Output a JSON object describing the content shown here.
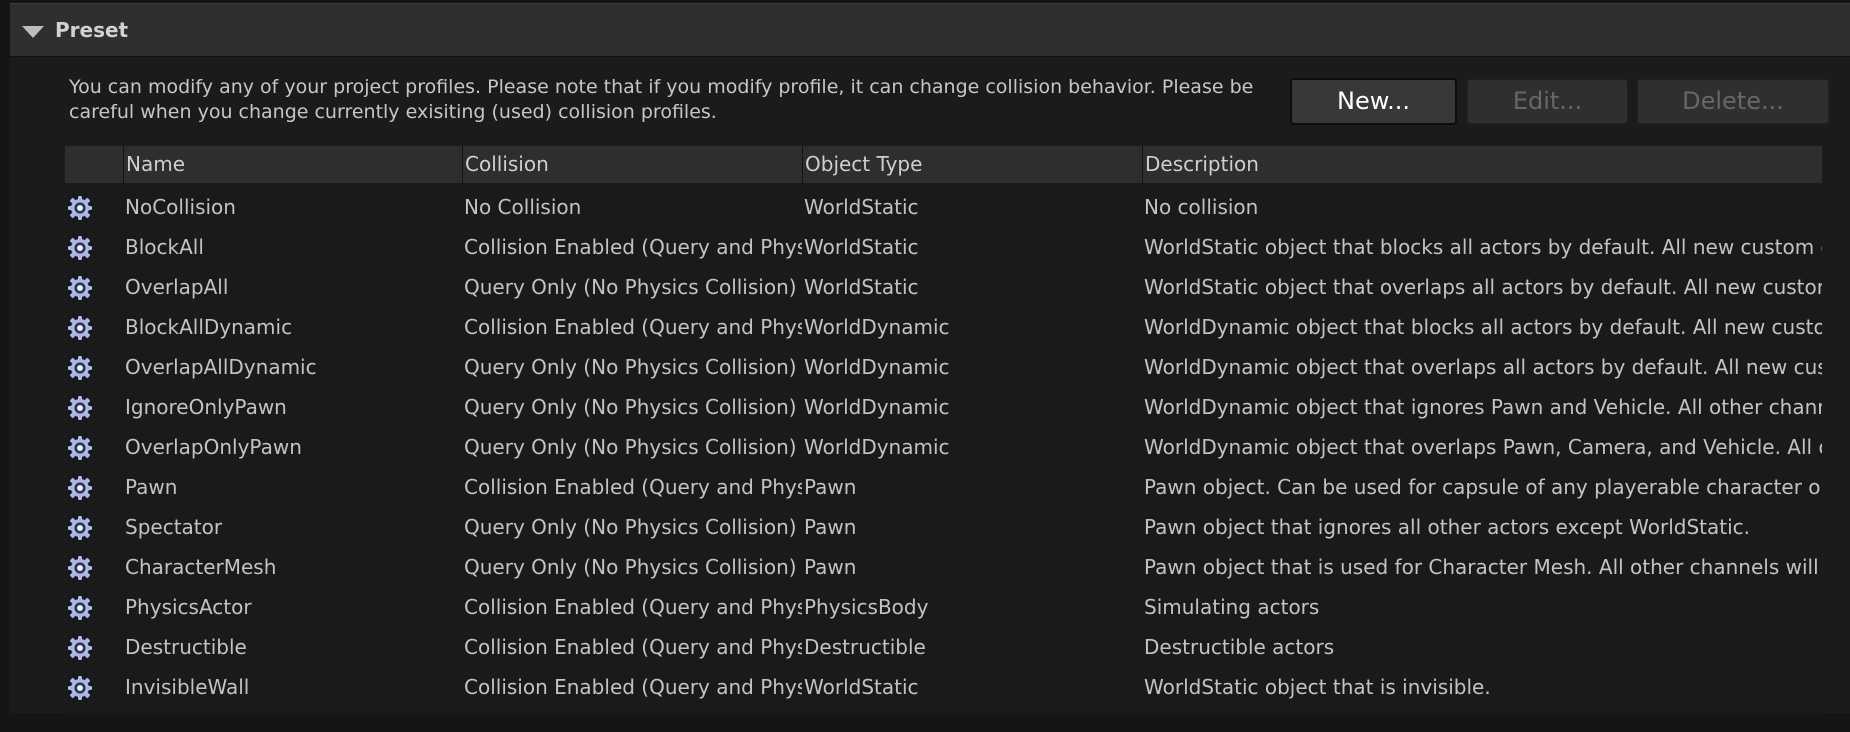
{
  "section": {
    "title": "Preset"
  },
  "notice": "You can modify any of your project profiles. Please note that if you modify profile, it can change collision behavior. Please be careful when you change currently exisiting (used) collision profiles.",
  "buttons": {
    "new": "New...",
    "edit": "Edit...",
    "delete": "Delete..."
  },
  "table": {
    "headers": {
      "name": "Name",
      "collision": "Collision",
      "object_type": "Object Type",
      "description": "Description"
    },
    "rows": [
      {
        "name": "NoCollision",
        "collision": "No Collision",
        "object_type": "WorldStatic",
        "description": "No collision"
      },
      {
        "name": "BlockAll",
        "collision": "Collision Enabled (Query and Physic",
        "object_type": "WorldStatic",
        "description": "WorldStatic object that blocks all actors by default. All new custom chan"
      },
      {
        "name": "OverlapAll",
        "collision": "Query Only (No Physics Collision)",
        "object_type": "WorldStatic",
        "description": "WorldStatic object that overlaps all actors by default. All new custom cha"
      },
      {
        "name": "BlockAllDynamic",
        "collision": "Collision Enabled (Query and Physic",
        "object_type": "WorldDynamic",
        "description": "WorldDynamic object that blocks all actors by default. All new custom ch"
      },
      {
        "name": "OverlapAllDynamic",
        "collision": "Query Only (No Physics Collision)",
        "object_type": "WorldDynamic",
        "description": "WorldDynamic object that overlaps all actors by default. All new custom"
      },
      {
        "name": "IgnoreOnlyPawn",
        "collision": "Query Only (No Physics Collision)",
        "object_type": "WorldDynamic",
        "description": "WorldDynamic object that ignores Pawn and Vehicle. All other channels w"
      },
      {
        "name": "OverlapOnlyPawn",
        "collision": "Query Only (No Physics Collision)",
        "object_type": "WorldDynamic",
        "description": "WorldDynamic object that overlaps Pawn, Camera, and Vehicle. All other"
      },
      {
        "name": "Pawn",
        "collision": "Collision Enabled (Query and Physic",
        "object_type": "Pawn",
        "description": "Pawn object. Can be used for capsule of any playerable character or AI."
      },
      {
        "name": "Spectator",
        "collision": "Query Only (No Physics Collision)",
        "object_type": "Pawn",
        "description": "Pawn object that ignores all other actors except WorldStatic."
      },
      {
        "name": "CharacterMesh",
        "collision": "Query Only (No Physics Collision)",
        "object_type": "Pawn",
        "description": "Pawn object that is used for Character Mesh. All other channels will be se"
      },
      {
        "name": "PhysicsActor",
        "collision": "Collision Enabled (Query and Physic",
        "object_type": "PhysicsBody",
        "description": "Simulating actors"
      },
      {
        "name": "Destructible",
        "collision": "Collision Enabled (Query and Physic",
        "object_type": "Destructible",
        "description": "Destructible actors"
      },
      {
        "name": "InvisibleWall",
        "collision": "Collision Enabled (Query and Physic",
        "object_type": "WorldStatic",
        "description": "WorldStatic object that is invisible."
      }
    ]
  },
  "icons": {
    "row_icon": "gear-icon",
    "collapse": "triangle-down-icon"
  }
}
